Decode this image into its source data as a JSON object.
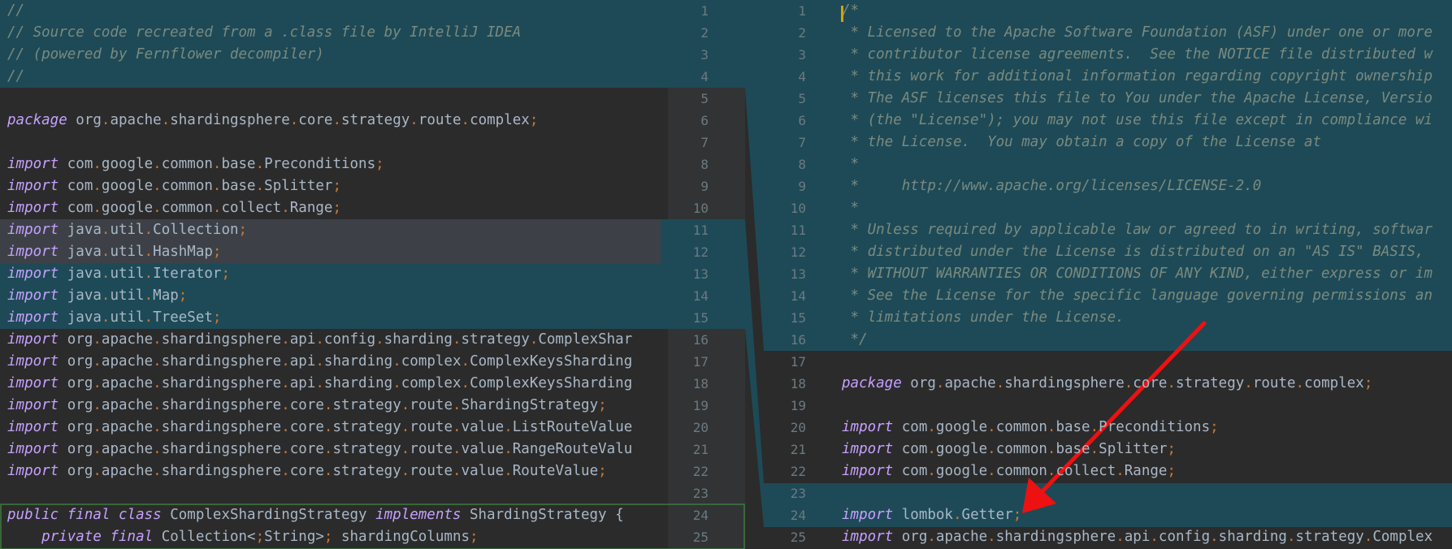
{
  "left": {
    "lines": [
      {
        "t": "//",
        "cls": "com"
      },
      {
        "t": "// Source code recreated from a .class file by IntelliJ IDEA",
        "cls": "com"
      },
      {
        "t": "// (powered by Fernflower decompiler)",
        "cls": "com"
      },
      {
        "t": "//",
        "cls": "com"
      },
      {
        "t": ""
      },
      {
        "t": "package org.apache.shardingsphere.core.strategy.route.complex;"
      },
      {
        "t": ""
      },
      {
        "t": "import com.google.common.base.Preconditions;"
      },
      {
        "t": "import com.google.common.base.Splitter;"
      },
      {
        "t": "import com.google.common.collect.Range;"
      },
      {
        "t": "import java.util.Collection;"
      },
      {
        "t": "import java.util.HashMap;"
      },
      {
        "t": "import java.util.Iterator;"
      },
      {
        "t": "import java.util.Map;"
      },
      {
        "t": "import java.util.TreeSet;"
      },
      {
        "t": "import org.apache.shardingsphere.api.config.sharding.strategy.ComplexShar"
      },
      {
        "t": "import org.apache.shardingsphere.api.sharding.complex.ComplexKeysSharding"
      },
      {
        "t": "import org.apache.shardingsphere.api.sharding.complex.ComplexKeysSharding"
      },
      {
        "t": "import org.apache.shardingsphere.core.strategy.route.ShardingStrategy;"
      },
      {
        "t": "import org.apache.shardingsphere.core.strategy.route.value.ListRouteValue"
      },
      {
        "t": "import org.apache.shardingsphere.core.strategy.route.value.RangeRouteValu"
      },
      {
        "t": "import org.apache.shardingsphere.core.strategy.route.value.RouteValue;"
      },
      {
        "t": ""
      },
      {
        "t": "public final class ComplexShardingStrategy implements ShardingStrategy {"
      },
      {
        "t": "    private final Collection<String> shardingColumns;"
      }
    ],
    "line_numbers": [
      "1",
      "2",
      "3",
      "4",
      "5",
      "6",
      "7",
      "8",
      "9",
      "10",
      "11",
      "12",
      "13",
      "14",
      "15",
      "16",
      "17",
      "18",
      "19",
      "20",
      "21",
      "22",
      "23",
      "24",
      "25"
    ]
  },
  "right": {
    "lines": [
      {
        "t": "/*",
        "cls": "com"
      },
      {
        "t": " * Licensed to the Apache Software Foundation (ASF) under one or more",
        "cls": "com"
      },
      {
        "t": " * contributor license agreements.  See the NOTICE file distributed w",
        "cls": "com"
      },
      {
        "t": " * this work for additional information regarding copyright ownership",
        "cls": "com"
      },
      {
        "t": " * The ASF licenses this file to You under the Apache License, Versio",
        "cls": "com"
      },
      {
        "t": " * (the \"License\"); you may not use this file except in compliance wi",
        "cls": "com"
      },
      {
        "t": " * the License.  You may obtain a copy of the License at",
        "cls": "com"
      },
      {
        "t": " *",
        "cls": "com"
      },
      {
        "t": " *     http://www.apache.org/licenses/LICENSE-2.0",
        "cls": "com"
      },
      {
        "t": " *",
        "cls": "com"
      },
      {
        "t": " * Unless required by applicable law or agreed to in writing, softwar",
        "cls": "com"
      },
      {
        "t": " * distributed under the License is distributed on an \"AS IS\" BASIS,",
        "cls": "com"
      },
      {
        "t": " * WITHOUT WARRANTIES OR CONDITIONS OF ANY KIND, either express or im",
        "cls": "com"
      },
      {
        "t": " * See the License for the specific language governing permissions an",
        "cls": "com"
      },
      {
        "t": " * limitations under the License.",
        "cls": "com"
      },
      {
        "t": " */",
        "cls": "com"
      },
      {
        "t": ""
      },
      {
        "t": "package org.apache.shardingsphere.core.strategy.route.complex;"
      },
      {
        "t": ""
      },
      {
        "t": "import com.google.common.base.Preconditions;"
      },
      {
        "t": "import com.google.common.base.Splitter;"
      },
      {
        "t": "import com.google.common.collect.Range;"
      },
      {
        "t": ""
      },
      {
        "t": "import lombok.Getter;"
      },
      {
        "t": "import org.apache.shardingsphere.api.config.sharding.strategy.Complex"
      }
    ],
    "line_numbers": [
      "1",
      "2",
      "3",
      "4",
      "5",
      "6",
      "7",
      "8",
      "9",
      "10",
      "11",
      "12",
      "13",
      "14",
      "15",
      "16",
      "17",
      "18",
      "19",
      "20",
      "21",
      "22",
      "23",
      "24",
      "25"
    ]
  },
  "colors": {
    "keyword": "#cc7832",
    "comment": "#7a8a7f",
    "change_highlight": "#1e4a57",
    "annotation_arrow": "#ee1111"
  }
}
